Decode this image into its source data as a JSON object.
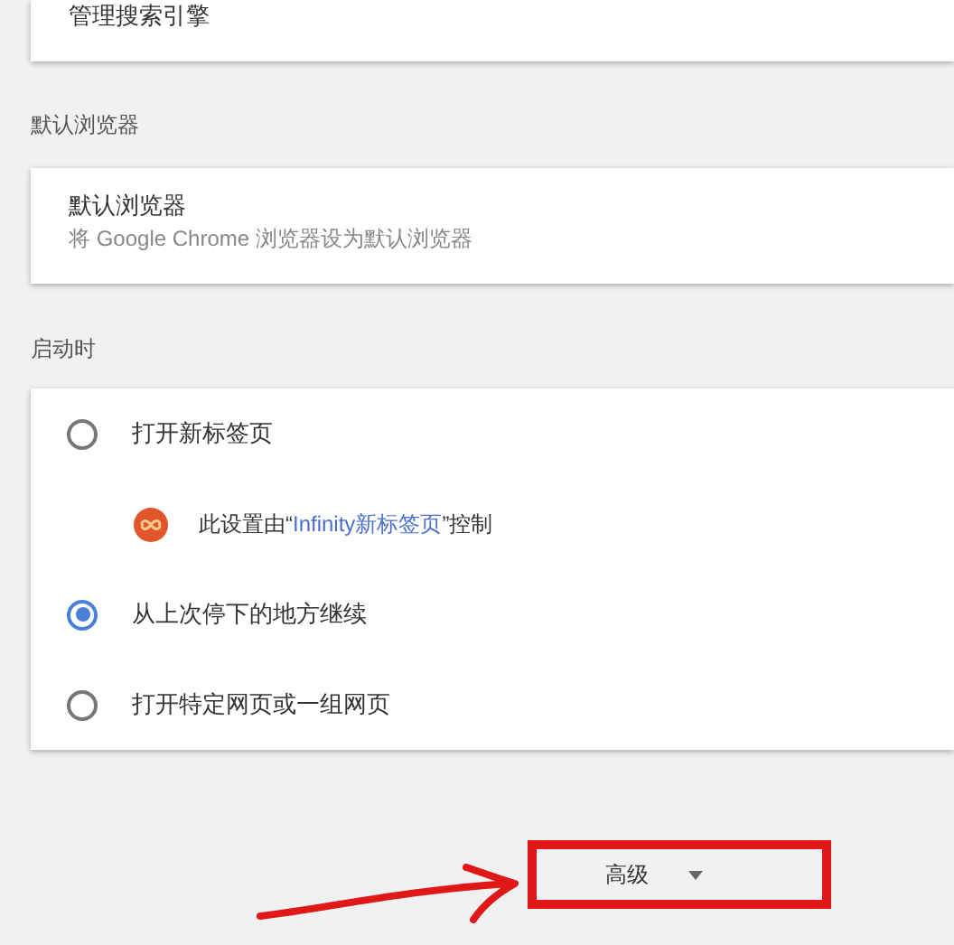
{
  "search_engine_card": {
    "title": "管理搜索引擎"
  },
  "default_browser": {
    "heading": "默认浏览器",
    "title": "默认浏览器",
    "subtitle": "将 Google Chrome 浏览器设为默认浏览器"
  },
  "on_startup": {
    "heading": "启动时",
    "options": [
      {
        "label": "打开新标签页",
        "selected": false,
        "notice": {
          "prefix": "此设置由“",
          "link": "Infinity新标签页",
          "suffix": "”控制"
        }
      },
      {
        "label": "从上次停下的地方继续",
        "selected": true
      },
      {
        "label": "打开特定网页或一组网页",
        "selected": false
      }
    ]
  },
  "advanced_button": {
    "label": "高级"
  }
}
